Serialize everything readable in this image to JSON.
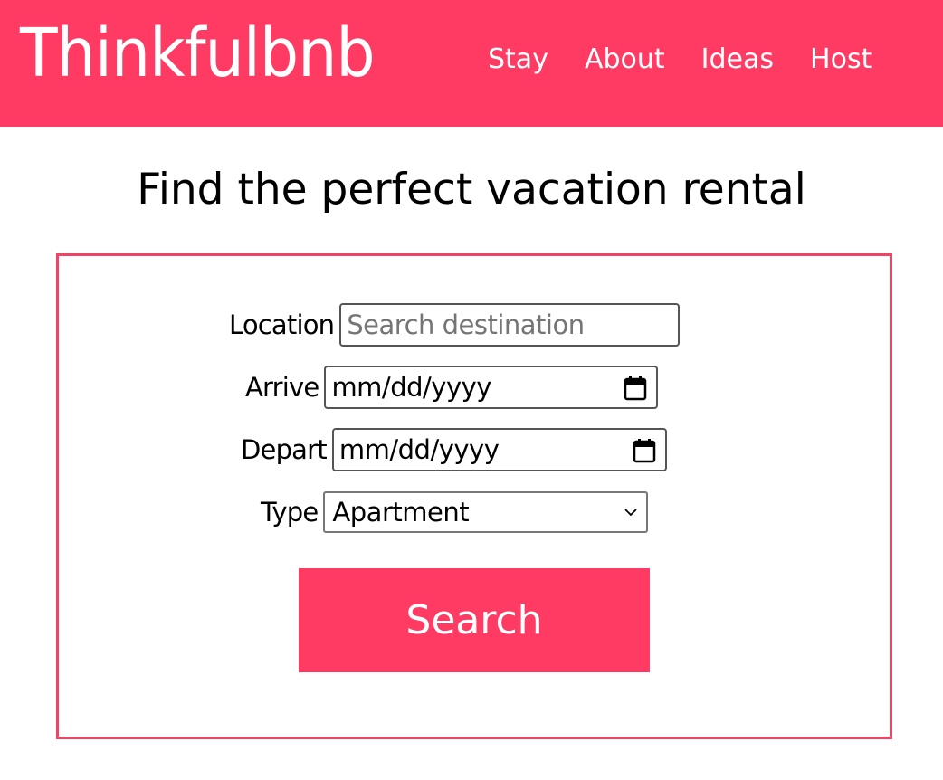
{
  "header": {
    "logo": "Thinkfulbnb",
    "nav": [
      {
        "label": "Stay"
      },
      {
        "label": "About"
      },
      {
        "label": "Ideas"
      },
      {
        "label": "Host"
      }
    ]
  },
  "main": {
    "title": "Find the perfect vacation rental"
  },
  "form": {
    "location": {
      "label": "Location",
      "placeholder": "Search destination",
      "value": ""
    },
    "arrive": {
      "label": "Arrive",
      "value": "mm/dd/yyyy"
    },
    "depart": {
      "label": "Depart",
      "value": "mm/dd/yyyy"
    },
    "type": {
      "label": "Type",
      "selected": "Apartment"
    },
    "submit_label": "Search"
  },
  "colors": {
    "brand": "#ff3b63",
    "form_border": "#ee4466"
  },
  "icons": {
    "date_picker": "calendar-icon",
    "select": "chevron-down-icon"
  }
}
